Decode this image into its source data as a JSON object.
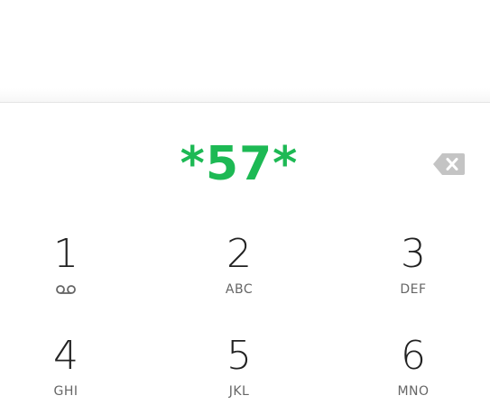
{
  "dialer": {
    "input_value": "*57*",
    "accent_color": "#1db954",
    "backspace_icon": "backspace-icon"
  },
  "keypad": {
    "keys": [
      {
        "digit": "1",
        "letters": "",
        "icon": "voicemail-icon"
      },
      {
        "digit": "2",
        "letters": "ABC"
      },
      {
        "digit": "3",
        "letters": "DEF"
      },
      {
        "digit": "4",
        "letters": "GHI"
      },
      {
        "digit": "5",
        "letters": "JKL"
      },
      {
        "digit": "6",
        "letters": "MNO"
      }
    ]
  }
}
